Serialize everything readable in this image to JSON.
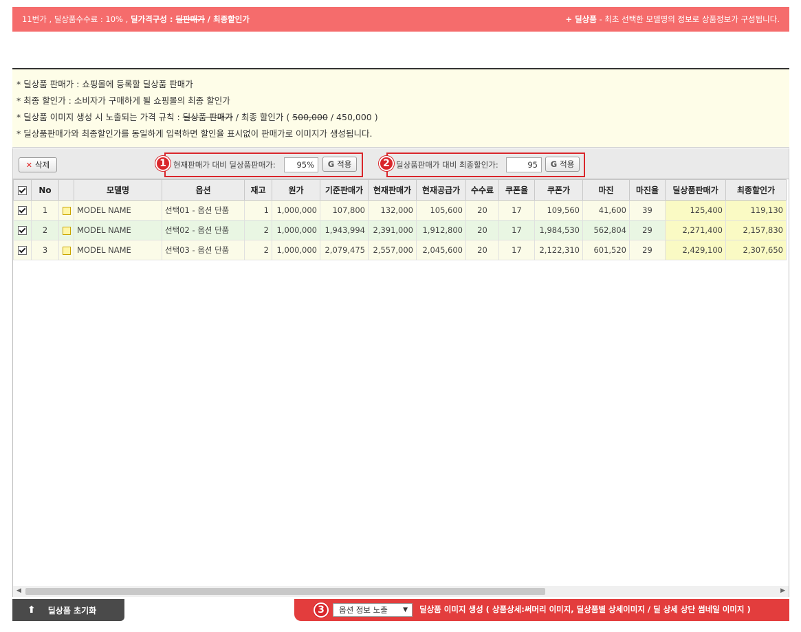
{
  "topbar": {
    "left_prefix": "11번가 , 딜상품수수료 : 10% , ",
    "left_bold": "딜가격구성 : ",
    "left_strike": "딜판매가",
    "left_suffix": " / 최종할인가",
    "right_bold": "+ 딜상품",
    "right_text": " - 최초 선택한 모델명의 정보로 상품정보가 구성됩니다."
  },
  "notice": {
    "line1": "* 딜상품 판매가 : 쇼핑몰에 등록할 딜상품 판매가",
    "line2": "* 최종 할인가 : 소비자가 구매하게 될 쇼핑몰의 최종 할인가",
    "line3_prefix": "* 딜상품 이미지 생성 시 노출되는 가격 규칙 : ",
    "line3_strike": "딜상품 판매가",
    "line3_mid": " / 최종 할인가 ( ",
    "line3_strike_val": "500,000",
    "line3_suffix": " / 450,000 )",
    "line4": "* 딜상품판매가와 최종할인가를 동일하게 입력하면 할인율 표시없이 판매가로 이미지가 생성됩니다."
  },
  "toolbar": {
    "delete_label": "삭제",
    "badge1": "1",
    "rate1_label": "현재판매가 대비 딜상품판매가:",
    "rate1_value": "95%",
    "apply1_label": "적용",
    "badge2": "2",
    "rate2_label": "딜상품판매가 대비 최종할인가:",
    "rate2_value": "95",
    "apply2_label": "적용",
    "g_icon": "G"
  },
  "table": {
    "headers": [
      "",
      "No",
      "",
      "모델명",
      "옵션",
      "재고",
      "원가",
      "기준판매가",
      "현재판매가",
      "현재공급가",
      "수수료",
      "쿠폰율",
      "쿠폰가",
      "마진",
      "마진율",
      "딜상품판매가",
      "최종할인가"
    ],
    "rows": [
      {
        "no": "1",
        "model": "MODEL NAME",
        "option": "선택01 - 옵션 단품",
        "stock": "1",
        "cost": "1,000,000",
        "base_price": "107,800",
        "cur_price": "132,000",
        "cur_supply": "105,600",
        "fee": "20",
        "coupon_rate": "17",
        "coupon_price": "109,560",
        "margin": "41,600",
        "margin_rate": "39",
        "deal_price": "125,400",
        "final_price": "119,130"
      },
      {
        "no": "2",
        "model": "MODEL NAME",
        "option": "선택02 - 옵션 단품",
        "stock": "2",
        "cost": "1,000,000",
        "base_price": "1,943,994",
        "cur_price": "2,391,000",
        "cur_supply": "1,912,800",
        "fee": "20",
        "coupon_rate": "17",
        "coupon_price": "1,984,530",
        "margin": "562,804",
        "margin_rate": "29",
        "deal_price": "2,271,400",
        "final_price": "2,157,830"
      },
      {
        "no": "3",
        "model": "MODEL NAME",
        "option": "선택03 - 옵션 단품",
        "stock": "2",
        "cost": "1,000,000",
        "base_price": "2,079,475",
        "cur_price": "2,557,000",
        "cur_supply": "2,045,600",
        "fee": "20",
        "coupon_rate": "17",
        "coupon_price": "2,122,310",
        "margin": "601,520",
        "margin_rate": "29",
        "deal_price": "2,429,100",
        "final_price": "2,307,650"
      }
    ]
  },
  "footer": {
    "reset_label": "딜상품 초기화",
    "badge3": "3",
    "select_value": "옵션 정보 노출",
    "generate_label": "딜상품 이미지 생성 ( 상품상세:써머리 이미지, 딜상품별 상세이미지 / 딜 상세 상단 썸네일 이미지 )"
  },
  "colors": {
    "topbar_bg": "#f56c6c",
    "notice_bg": "#fefde8",
    "highlight_red": "#d9262b",
    "generate_bg": "#e33d3d",
    "reset_bg": "#4a4a4a",
    "deal_col_bg": "#fafac4"
  },
  "icons": [
    "delete-x-icon",
    "g-apply-icon",
    "memo-icon",
    "checkbox-icon",
    "up-arrow-icon",
    "dropdown-caret-icon"
  ]
}
